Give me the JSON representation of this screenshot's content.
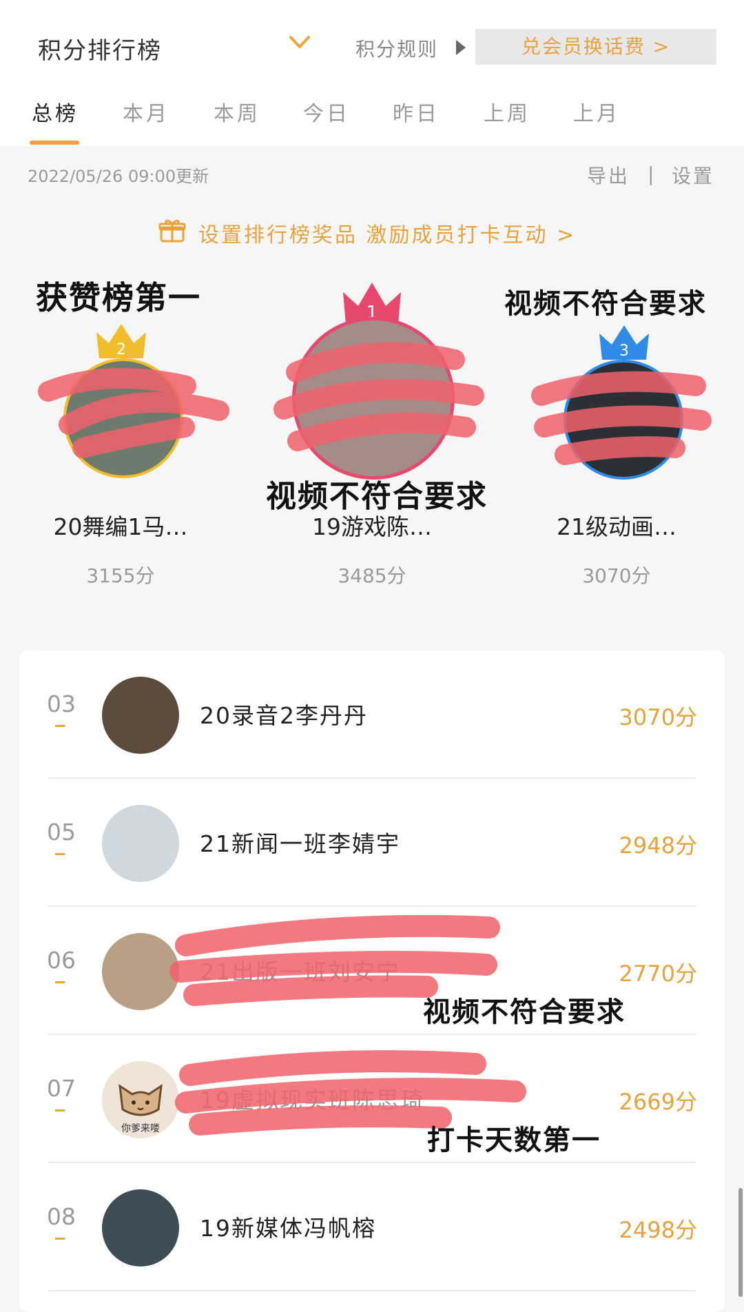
{
  "header": {
    "title": "积分排行榜",
    "rules_label": "积分规则",
    "redeem_label": "兑会员换话费 >"
  },
  "tabs": [
    {
      "label": "总榜",
      "active": true
    },
    {
      "label": "本月"
    },
    {
      "label": "本周"
    },
    {
      "label": "今日"
    },
    {
      "label": "昨日"
    },
    {
      "label": "上周"
    },
    {
      "label": "上月"
    }
  ],
  "meta": {
    "updated": "2022/05/26 09:00更新",
    "export_label": "导出",
    "separator": "|",
    "settings_label": "设置"
  },
  "promo_text": "设置排行榜奖品 激励成员打卡互动 >",
  "podium": [
    {
      "rank_label": "2",
      "name": "20舞编1马…",
      "score": "3155分",
      "crown_color": "#f2bd2c",
      "ring_color": "#f2bd2c"
    },
    {
      "rank_label": "1",
      "name": "19游戏陈…",
      "score": "3485分",
      "crown_color": "#e8486e",
      "ring_color": "#e8486e"
    },
    {
      "rank_label": "3",
      "name": "21级动画…",
      "score": "3070分",
      "crown_color": "#2f8be6",
      "ring_color": "#2f8be6"
    }
  ],
  "annotations": {
    "top_left": "获赞榜第一",
    "top_right": "视频不符合要求",
    "center": "视频不符合要求",
    "row6": "视频不符合要求",
    "row7": "打卡天数第一"
  },
  "list": [
    {
      "rank": "03",
      "name": "20录音2李丹丹",
      "score": "3070分",
      "avatar_bg": "#5b4b3c"
    },
    {
      "rank": "05",
      "name": "21新闻一班李婧宇",
      "score": "2948分",
      "avatar_bg": "#cfd8de"
    },
    {
      "rank": "06",
      "name": "21出版一班刘安宁",
      "score": "2770分",
      "avatar_bg": "#b9a084"
    },
    {
      "rank": "07",
      "name": "19虚拟现实班陈思琦",
      "score": "2669分",
      "avatar_bg": "#efe4d7",
      "avatar_text": "你爹来喽"
    },
    {
      "rank": "08",
      "name": "19新媒体冯帆榕",
      "score": "2498分",
      "avatar_bg": "#3e4d53"
    }
  ],
  "colors": {
    "accent": "#f0a33b",
    "scribble": "#f0626b"
  }
}
